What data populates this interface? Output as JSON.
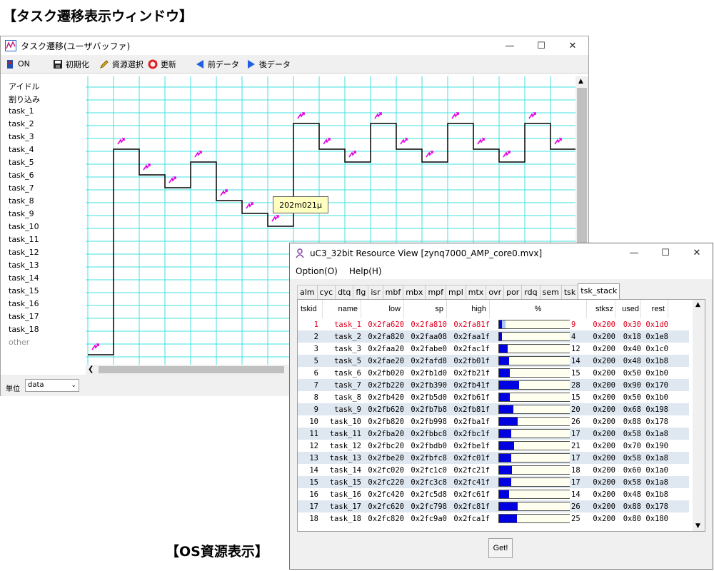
{
  "captions": {
    "top": "【タスク遷移表示ウィンドウ】",
    "bottom": "【OS資源表示】"
  },
  "win1": {
    "title": "タスク遷移(ユーザバッファ)",
    "toolbar": {
      "on": "ON",
      "init": "初期化",
      "resource": "資源選択",
      "refresh": "更新",
      "prev": "前データ",
      "next": "後データ"
    },
    "task_labels": [
      "アイドル",
      "割り込み",
      "task_1",
      "task_2",
      "task_3",
      "task_4",
      "task_5",
      "task_6",
      "task_7",
      "task_8",
      "task_9",
      "task_10",
      "task_11",
      "task_12",
      "task_13",
      "task_14",
      "task_15",
      "task_16",
      "task_17",
      "task_18",
      "other"
    ],
    "tooltip": "202m021μ",
    "unit_label": "単位",
    "unit_value": "data",
    "colors": {
      "grid": "#40e0e0",
      "trace": "#000000",
      "marker": "#e000e0"
    }
  },
  "chart_data": {
    "type": "line",
    "title": "",
    "xlabel": "",
    "ylabel": "",
    "rows": [
      "アイドル",
      "割り込み",
      "task_1",
      "task_2",
      "task_3",
      "task_4",
      "task_5",
      "task_6",
      "task_7",
      "task_8",
      "task_9",
      "task_10",
      "task_11",
      "task_12",
      "task_13",
      "task_14",
      "task_15",
      "task_16",
      "task_17",
      "task_18",
      "other"
    ],
    "series": [
      {
        "x": [
          0,
          1,
          2,
          3,
          4,
          5,
          6,
          7,
          8,
          9,
          10,
          11,
          12,
          13,
          14,
          15,
          16,
          17,
          18,
          19
        ],
        "y": [
          "other",
          "task_3",
          "task_5",
          "task_6",
          "task_4",
          "task_7",
          "task_8",
          "task_9",
          "task_1",
          "task_3",
          "task_4",
          "task_1",
          "task_3",
          "task_4",
          "task_1",
          "task_3",
          "task_4",
          "task_1",
          "task_3",
          "task_3"
        ]
      }
    ],
    "grid": true
  },
  "win2": {
    "title": "uC3_32bit Resource View [zynq7000_AMP_core0.mvx]",
    "menu": [
      "Option(O)",
      "Help(H)"
    ],
    "tabs": [
      "alm",
      "cyc",
      "dtq",
      "flg",
      "isr",
      "mbf",
      "mbx",
      "mpf",
      "mpl",
      "mtx",
      "ovr",
      "por",
      "rdq",
      "sem",
      "tsk",
      "tsk_stack"
    ],
    "active_tab": "tsk_stack",
    "columns": [
      "tskid",
      "name",
      "low",
      "sp",
      "high",
      "%",
      "stksz",
      "used",
      "rest"
    ],
    "rows": [
      {
        "id": "1",
        "name": "task_1",
        "low": "0x2fa620",
        "sp": "0x2fa810",
        "high": "0x2fa81f",
        "pct": "9",
        "stksz": "0x200",
        "used": "0x30",
        "rest": "0x1d0"
      },
      {
        "id": "2",
        "name": "task_2",
        "low": "0x2fa820",
        "sp": "0x2faa08",
        "high": "0x2faa1f",
        "pct": "4",
        "stksz": "0x200",
        "used": "0x18",
        "rest": "0x1e8"
      },
      {
        "id": "3",
        "name": "task_3",
        "low": "0x2faa20",
        "sp": "0x2fabe0",
        "high": "0x2fac1f",
        "pct": "12",
        "stksz": "0x200",
        "used": "0x40",
        "rest": "0x1c0"
      },
      {
        "id": "5",
        "name": "task_5",
        "low": "0x2fae20",
        "sp": "0x2fafd8",
        "high": "0x2fb01f",
        "pct": "14",
        "stksz": "0x200",
        "used": "0x48",
        "rest": "0x1b8"
      },
      {
        "id": "6",
        "name": "task_6",
        "low": "0x2fb020",
        "sp": "0x2fb1d0",
        "high": "0x2fb21f",
        "pct": "15",
        "stksz": "0x200",
        "used": "0x50",
        "rest": "0x1b0"
      },
      {
        "id": "7",
        "name": "task_7",
        "low": "0x2fb220",
        "sp": "0x2fb390",
        "high": "0x2fb41f",
        "pct": "28",
        "stksz": "0x200",
        "used": "0x90",
        "rest": "0x170"
      },
      {
        "id": "8",
        "name": "task_8",
        "low": "0x2fb420",
        "sp": "0x2fb5d0",
        "high": "0x2fb61f",
        "pct": "15",
        "stksz": "0x200",
        "used": "0x50",
        "rest": "0x1b0"
      },
      {
        "id": "9",
        "name": "task_9",
        "low": "0x2fb620",
        "sp": "0x2fb7b8",
        "high": "0x2fb81f",
        "pct": "20",
        "stksz": "0x200",
        "used": "0x68",
        "rest": "0x198"
      },
      {
        "id": "10",
        "name": "task_10",
        "low": "0x2fb820",
        "sp": "0x2fb998",
        "high": "0x2fba1f",
        "pct": "26",
        "stksz": "0x200",
        "used": "0x88",
        "rest": "0x178"
      },
      {
        "id": "11",
        "name": "task_11",
        "low": "0x2fba20",
        "sp": "0x2fbbc8",
        "high": "0x2fbc1f",
        "pct": "17",
        "stksz": "0x200",
        "used": "0x58",
        "rest": "0x1a8"
      },
      {
        "id": "12",
        "name": "task_12",
        "low": "0x2fbc20",
        "sp": "0x2fbdb0",
        "high": "0x2fbe1f",
        "pct": "21",
        "stksz": "0x200",
        "used": "0x70",
        "rest": "0x190"
      },
      {
        "id": "13",
        "name": "task_13",
        "low": "0x2fbe20",
        "sp": "0x2fbfc8",
        "high": "0x2fc01f",
        "pct": "17",
        "stksz": "0x200",
        "used": "0x58",
        "rest": "0x1a8"
      },
      {
        "id": "14",
        "name": "task_14",
        "low": "0x2fc020",
        "sp": "0x2fc1c0",
        "high": "0x2fc21f",
        "pct": "18",
        "stksz": "0x200",
        "used": "0x60",
        "rest": "0x1a0"
      },
      {
        "id": "15",
        "name": "task_15",
        "low": "0x2fc220",
        "sp": "0x2fc3c8",
        "high": "0x2fc41f",
        "pct": "17",
        "stksz": "0x200",
        "used": "0x58",
        "rest": "0x1a8"
      },
      {
        "id": "16",
        "name": "task_16",
        "low": "0x2fc420",
        "sp": "0x2fc5d8",
        "high": "0x2fc61f",
        "pct": "14",
        "stksz": "0x200",
        "used": "0x48",
        "rest": "0x1b8"
      },
      {
        "id": "17",
        "name": "task_17",
        "low": "0x2fc620",
        "sp": "0x2fc798",
        "high": "0x2fc81f",
        "pct": "26",
        "stksz": "0x200",
        "used": "0x88",
        "rest": "0x178"
      },
      {
        "id": "18",
        "name": "task_18",
        "low": "0x2fc820",
        "sp": "0x2fc9a0",
        "high": "0x2fca1f",
        "pct": "25",
        "stksz": "0x200",
        "used": "0x80",
        "rest": "0x180"
      }
    ],
    "get_button": "Get!",
    "colors": {
      "bar": "#0000e0",
      "bar_light": "#a8c8f0",
      "highlight_text": "#e00020",
      "row_alt": "#dfe7f0"
    }
  }
}
